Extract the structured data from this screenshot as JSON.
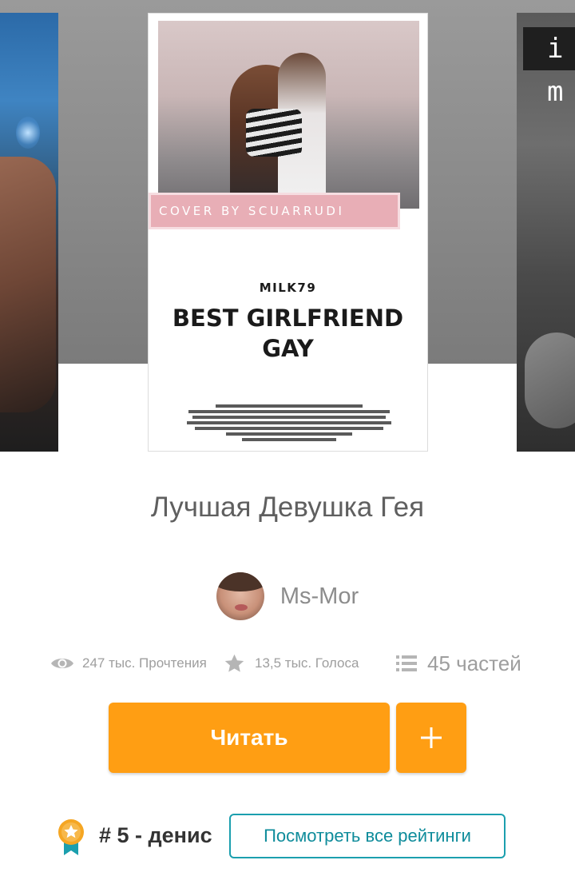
{
  "carousel": {
    "left_cover_icon": "book-cover-image",
    "right_cover": {
      "title_fragment": "i m"
    },
    "main_cover": {
      "ribbon_text": "COVER BY SCUARRUDI",
      "author": "MILK79",
      "title_line1": "BEST GIRLFRIEND",
      "title_line2": "GAY"
    }
  },
  "book": {
    "title": "Лучшая Девушка Гея",
    "author_name": "Ms-Mor"
  },
  "stats": {
    "reads": "247 тыс. Прочтения",
    "votes": "13,5 тыс. Голоса",
    "parts": "45 частей"
  },
  "actions": {
    "read_label": "Читать",
    "add_icon": "plus-icon"
  },
  "ranking": {
    "text": "# 5 - денис",
    "button_label": "Посмотреть все рейтинги"
  },
  "colors": {
    "accent": "#ff9e13",
    "teal": "#1b9fae",
    "ribbon": "#e8aeb6",
    "badge": "#f5a623"
  }
}
